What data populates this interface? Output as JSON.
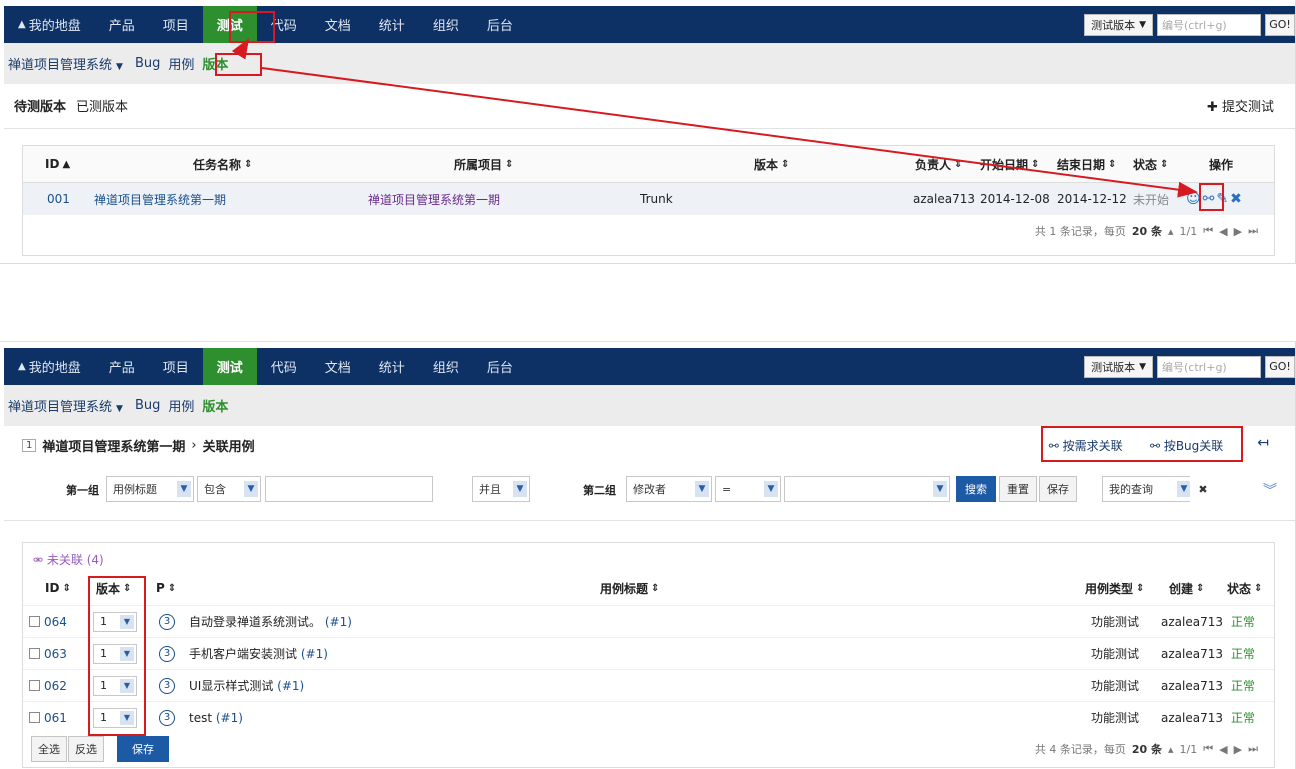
{
  "nav": {
    "items": [
      "我的地盘",
      "产品",
      "项目",
      "测试",
      "代码",
      "文档",
      "统计",
      "组织",
      "后台"
    ],
    "active_index": 3,
    "version_select": "测试版本",
    "number_placeholder": "编号(ctrl+g)",
    "go_label": "GO!"
  },
  "subnav": {
    "project": "禅道项目管理系统",
    "links": [
      "Bug",
      "用例",
      "版本"
    ],
    "active_link": "版本"
  },
  "panel1": {
    "tabs": [
      "待测版本",
      "已测版本"
    ],
    "submit_label": "提交测试",
    "columns": [
      "ID",
      "任务名称",
      "所属项目",
      "版本",
      "负责人",
      "开始日期",
      "结束日期",
      "状态",
      "操作"
    ],
    "rows": [
      {
        "id": "001",
        "task": "禅道项目管理系统第一期",
        "project": "禅道项目管理系统第一期",
        "build": "Trunk",
        "owner": "azalea713",
        "begin": "2014-12-08",
        "end": "2014-12-12",
        "status": "未开始"
      }
    ],
    "pager": {
      "summary": "共 1 条记录，每页",
      "per_page": "20 条",
      "pages": "1/1"
    }
  },
  "panel2": {
    "crumb_id": "1",
    "crumb_title": "禅道项目管理系统第一期",
    "crumb_sep": "›",
    "crumb_action": "关联用例",
    "link_by_story": "按需求关联",
    "link_by_bug": "按Bug关联",
    "filter": {
      "group1_label": "第一组",
      "group1_field": "用例标题",
      "group1_op": "包含",
      "andor": "并且",
      "group2_label": "第二组",
      "group2_field": "修改者",
      "group2_op": "=",
      "search": "搜索",
      "reset": "重置",
      "save": "保存",
      "my_query": "我的查询"
    },
    "group_title": "未关联 (4)",
    "columns": [
      "ID",
      "版本",
      "P",
      "用例标题",
      "用例类型",
      "创建",
      "状态"
    ],
    "rows": [
      {
        "id": "064",
        "version": "1",
        "pri": "3",
        "title": "自动登录禅道系统测试。",
        "ref": "(#1)",
        "type": "功能测试",
        "creator": "azalea713",
        "status": "正常"
      },
      {
        "id": "063",
        "version": "1",
        "pri": "3",
        "title": "手机客户端安装测试",
        "ref": "(#1)",
        "type": "功能测试",
        "creator": "azalea713",
        "status": "正常"
      },
      {
        "id": "062",
        "version": "1",
        "pri": "3",
        "title": "UI显示样式测试",
        "ref": "(#1)",
        "type": "功能测试",
        "creator": "azalea713",
        "status": "正常"
      },
      {
        "id": "061",
        "version": "1",
        "pri": "3",
        "title": "test",
        "ref": "(#1)",
        "type": "功能测试",
        "creator": "azalea713",
        "status": "正常"
      }
    ],
    "select_all": "全选",
    "invert": "反选",
    "save": "保存",
    "pager": {
      "summary": "共 4 条记录，每页",
      "per_page": "20 条",
      "pages": "1/1"
    }
  },
  "colors": {
    "nav_bg": "#0d3065",
    "active_tab": "#2e8f2e",
    "annotation": "#d71920",
    "link": "#1a4f8b"
  }
}
